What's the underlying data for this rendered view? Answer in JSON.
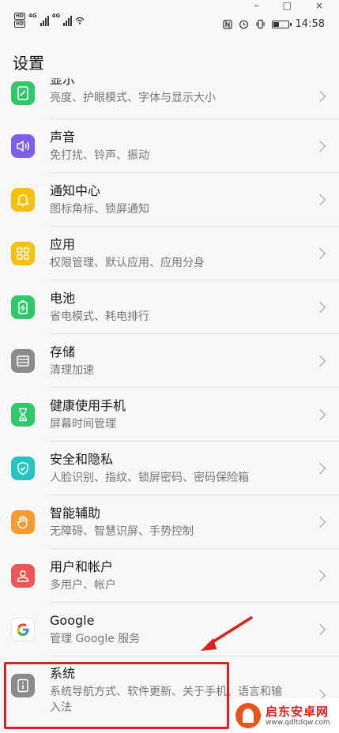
{
  "status_bar": {
    "hd1": "HD",
    "hd2": "HD",
    "net1": "4G",
    "net2": "4G",
    "time": "14:58",
    "battery_level": 0.45
  },
  "window_controls": [
    "–",
    "□",
    "×"
  ],
  "page": {
    "title": "设置"
  },
  "items": [
    {
      "title": "显示",
      "sub": "亮度、护眼模式、字体与显示大小",
      "icon": "display-icon",
      "color": "#2fc76a"
    },
    {
      "title": "声音",
      "sub": "免打扰、铃声、振动",
      "icon": "sound-icon",
      "color": "#7c5fe8"
    },
    {
      "title": "通知中心",
      "sub": "图标角标、锁屏通知",
      "icon": "bell-icon",
      "color": "#f6c10e"
    },
    {
      "title": "应用",
      "sub": "权限管理、默认应用、应用分身",
      "icon": "apps-icon",
      "color": "#f6c10e"
    },
    {
      "title": "电池",
      "sub": "省电模式、耗电排行",
      "icon": "battery-icon",
      "color": "#2fc76a"
    },
    {
      "title": "存储",
      "sub": "清理加速",
      "icon": "storage-icon",
      "color": "#8b8b8b"
    },
    {
      "title": "健康使用手机",
      "sub": "屏幕时间管理",
      "icon": "hourglass-icon",
      "color": "#2fc76a"
    },
    {
      "title": "安全和隐私",
      "sub": "人脸识别、指纹、锁屏密码、密码保险箱",
      "icon": "shield-icon",
      "color": "#25c4c0"
    },
    {
      "title": "智能辅助",
      "sub": "无障碍、智慧识屏、手势控制",
      "icon": "hand-icon",
      "color": "#f59b30"
    },
    {
      "title": "用户和帐户",
      "sub": "多用户、帐户",
      "icon": "user-icon",
      "color": "#ee5656"
    },
    {
      "title": "Google",
      "sub": "管理 Google 服务",
      "icon": "google-icon",
      "color": "#ffffff"
    },
    {
      "title": "系统",
      "sub": "系统导航方式、软件更新、关于手机、语言和输入法",
      "icon": "info-icon",
      "color": "#8b8b8b"
    }
  ],
  "watermark": {
    "name": "启东安卓网",
    "url": "www.qdltdqw.com"
  }
}
